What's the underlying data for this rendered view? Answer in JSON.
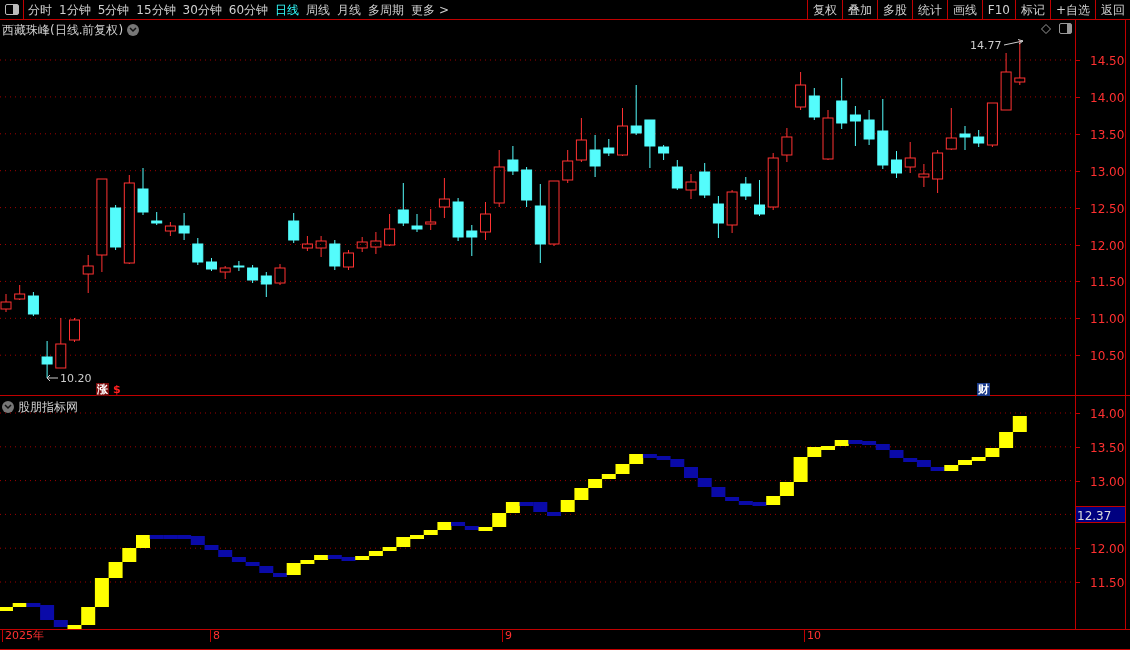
{
  "toolbar": {
    "periods": [
      {
        "label": "分时",
        "selected": false
      },
      {
        "label": "1分钟",
        "selected": false
      },
      {
        "label": "5分钟",
        "selected": false
      },
      {
        "label": "15分钟",
        "selected": false
      },
      {
        "label": "30分钟",
        "selected": false
      },
      {
        "label": "60分钟",
        "selected": false
      },
      {
        "label": "日线",
        "selected": true
      },
      {
        "label": "周线",
        "selected": false
      },
      {
        "label": "月线",
        "selected": false
      },
      {
        "label": "多周期",
        "selected": false
      },
      {
        "label": "更多 >",
        "selected": false
      }
    ],
    "actions": [
      "复权",
      "叠加",
      "多股",
      "统计",
      "画线",
      "F10",
      "标记",
      "+自选",
      "返回"
    ]
  },
  "price_panel": {
    "title": "西藏珠峰(日线.前复权)",
    "axis": [
      "14.50",
      "14.00",
      "13.50",
      "13.00",
      "12.50",
      "12.00",
      "11.50",
      "11.00",
      "10.50"
    ],
    "high_label": "14.77",
    "low_label": "10.20",
    "badges": [
      {
        "text": "涨",
        "kind": "boxed",
        "color": "#7a0a0a"
      },
      {
        "text": "$",
        "kind": "plain",
        "color": "#ff2020"
      },
      {
        "text": "财",
        "kind": "boxed",
        "color": "#1a3a8a"
      }
    ]
  },
  "indicator_panel": {
    "title": "股朋指标网",
    "axis": [
      "14.00",
      "13.50",
      "13.00",
      "12.00",
      "11.50"
    ],
    "current_value": "12.37"
  },
  "time_axis": [
    "2025年",
    "8",
    "9",
    "10"
  ]
}
